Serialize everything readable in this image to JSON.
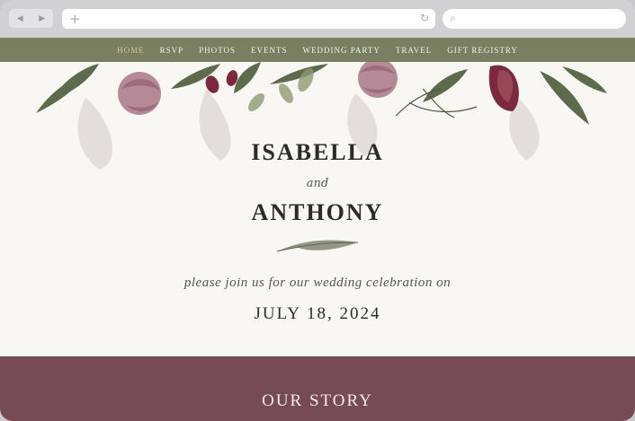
{
  "browser": {
    "back_icon": "back-arrow-icon",
    "forward_icon": "forward-arrow-icon",
    "back_glyph": "◀",
    "forward_glyph": "▶",
    "new_tab_glyph": "+",
    "reload_glyph": "↻",
    "search_glyph": "⌕"
  },
  "nav": {
    "items": [
      {
        "label": "HOME",
        "active": true
      },
      {
        "label": "RSVP"
      },
      {
        "label": "PHOTOS"
      },
      {
        "label": "EVENTS"
      },
      {
        "label": "WEDDING PARTY"
      },
      {
        "label": "TRAVEL"
      },
      {
        "label": "GIFT REGISTRY"
      }
    ]
  },
  "hero": {
    "name1": "ISABELLA",
    "and": "and",
    "name2": "ANTHONY",
    "invitation": "please join us for our wedding celebration on",
    "date": "JULY 18, 2024"
  },
  "story": {
    "title": "OUR STORY"
  },
  "colors": {
    "nav_bg": "#7a7f62",
    "nav_active": "#d7c3a2",
    "story_bg": "#774b54",
    "page_bg": "#f9f7f3"
  }
}
